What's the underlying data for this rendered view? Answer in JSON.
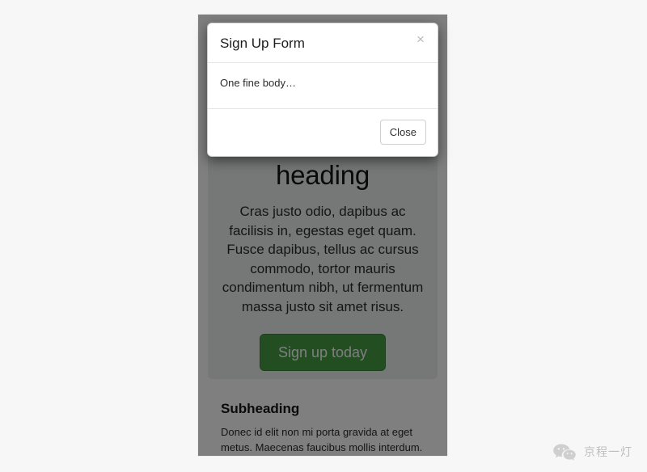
{
  "page": {
    "jumbotron": {
      "heading": "Jumbotron heading",
      "lead": "Cras justo odio, dapibus ac facilisis in, egestas eget quam. Fusce dapibus, tellus ac cursus commodo, tortor mauris condimentum nibh, ut fermentum massa justo sit amet risus.",
      "cta_label": "Sign up today",
      "cta_color": "#449d44"
    },
    "section": {
      "heading": "Subheading",
      "body": "Donec id elit non mi porta gravida at eget metus. Maecenas faucibus mollis interdum."
    }
  },
  "modal": {
    "title": "Sign Up Form",
    "close_icon": "close-icon",
    "close_glyph": "×",
    "body": "One fine body…",
    "footer": {
      "close_label": "Close"
    },
    "backdrop_color": "#000000",
    "backdrop_opacity": "0.5"
  },
  "watermark": {
    "icon": "wechat-icon",
    "text": "京程一灯"
  }
}
